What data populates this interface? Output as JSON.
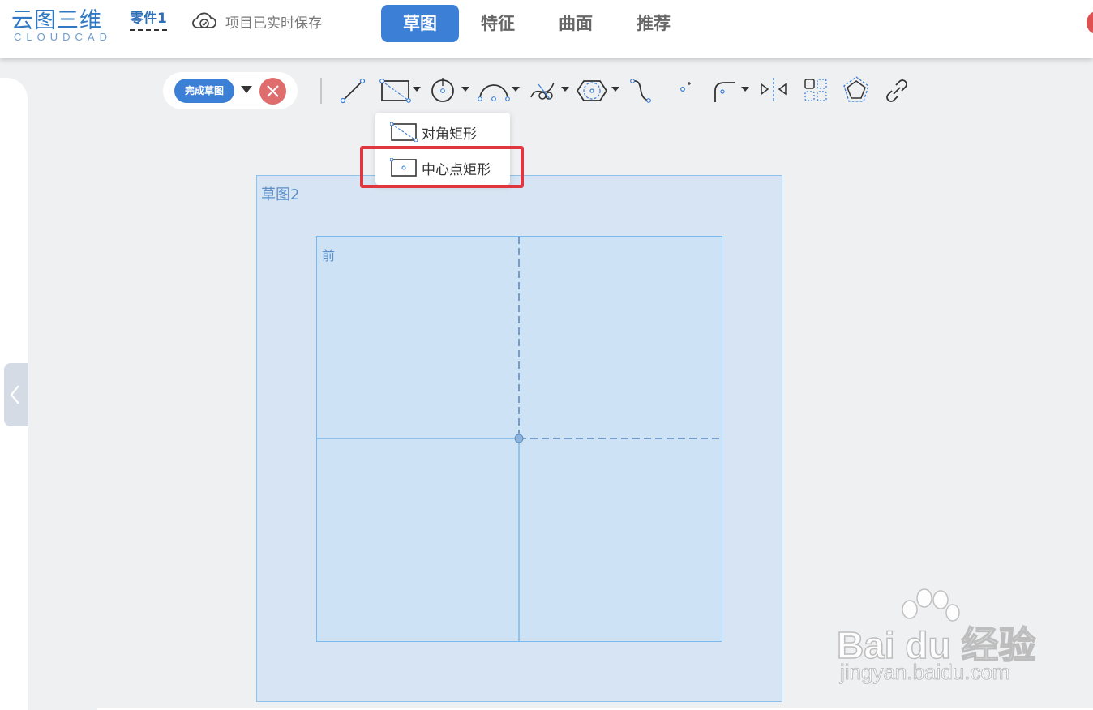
{
  "app": {
    "logo_text": "云图三维",
    "logo_subtitle": "CLOUDCAD",
    "part_name": "零件1",
    "save_status": "项目已实时保存"
  },
  "tabs": [
    {
      "label": "草图",
      "active": true
    },
    {
      "label": "特征",
      "active": false
    },
    {
      "label": "曲面",
      "active": false
    },
    {
      "label": "推荐",
      "active": false
    }
  ],
  "toolbar": {
    "finish_sketch_label": "完成草图",
    "tools": [
      "line-icon",
      "rectangle-icon",
      "circle-icon",
      "arc-icon",
      "trim-icon",
      "polygon-icon",
      "spline-icon",
      "point-icon",
      "fillet-icon",
      "mirror-icon",
      "pattern-icon",
      "offset-icon",
      "constraint-link-icon"
    ]
  },
  "rectangle_dropdown": {
    "items": [
      {
        "label": "对角矩形",
        "icon": "diagonal-rectangle-icon"
      },
      {
        "label": "中心点矩形",
        "icon": "center-rectangle-icon",
        "highlighted": true
      }
    ]
  },
  "canvas": {
    "sketch_label": "草图2",
    "plane_label": "前"
  },
  "watermark": {
    "logo": "Bai du 经验",
    "url": "jingyan.baidu.com"
  },
  "colors": {
    "accent": "#3b7fd6",
    "highlight": "#e0363f",
    "sketch_fill": "#d6e4f3",
    "plane_fill": "#cde2f4"
  }
}
